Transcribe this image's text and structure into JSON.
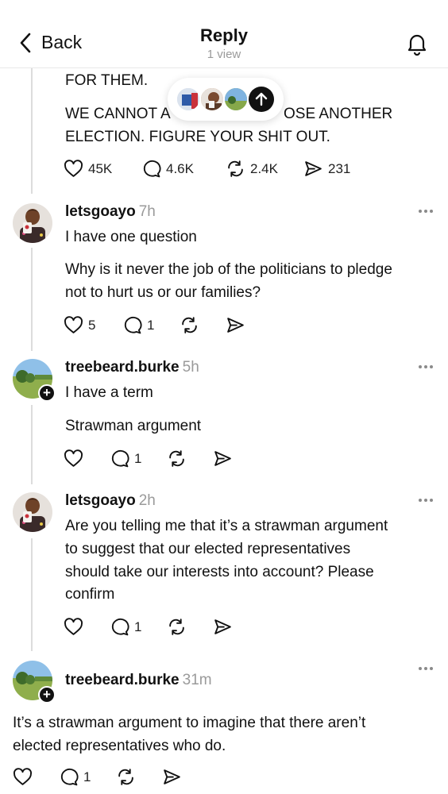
{
  "header": {
    "back_label": "Back",
    "title": "Reply",
    "subtitle": "1 view"
  },
  "top_post": {
    "line1": "FOR THEM.",
    "line2": "WE CANNOT A",
    "line2_right": "OSE ANOTHER",
    "line3": "ELECTION. FIGURE YOUR SHIT OUT.",
    "likes": "45K",
    "replies": "4.6K",
    "reposts": "2.4K",
    "shares": "231"
  },
  "replies": [
    {
      "user": "letsgoayo",
      "time": "7h",
      "line1": "I have one question",
      "line2": "Why is it never the job of the politicians to pledge",
      "line3": "not to hurt us or our families?",
      "likes": "5",
      "replies": "1"
    },
    {
      "user": "treebeard.burke",
      "time": "5h",
      "line1": "I have a term",
      "line2": "Strawman argument",
      "replies": "1"
    },
    {
      "user": "letsgoayo",
      "time": "2h",
      "line1": "Are you telling me that it’s a strawman argument",
      "line2": "to suggest that our elected representatives",
      "line3": "should take our interests into account? Please",
      "line4": "confirm",
      "replies": "1"
    },
    {
      "user": "treebeard.burke",
      "time": "31m",
      "line1": "It’s a strawman argument to imagine that there aren’t",
      "line2": "elected representatives who do.",
      "replies": "1"
    }
  ],
  "icons": {
    "back": "chevron-left-icon",
    "bell": "bell-icon",
    "like": "heart-icon",
    "reply": "comment-icon",
    "repost": "repost-icon",
    "share": "send-icon",
    "more": "more-dots-icon",
    "scroll_up": "arrow-up-icon"
  },
  "colors": {
    "text": "#111111",
    "muted": "#9a9a9a",
    "divider": "#e8e8e8",
    "thread_line": "#dcdcdc"
  }
}
